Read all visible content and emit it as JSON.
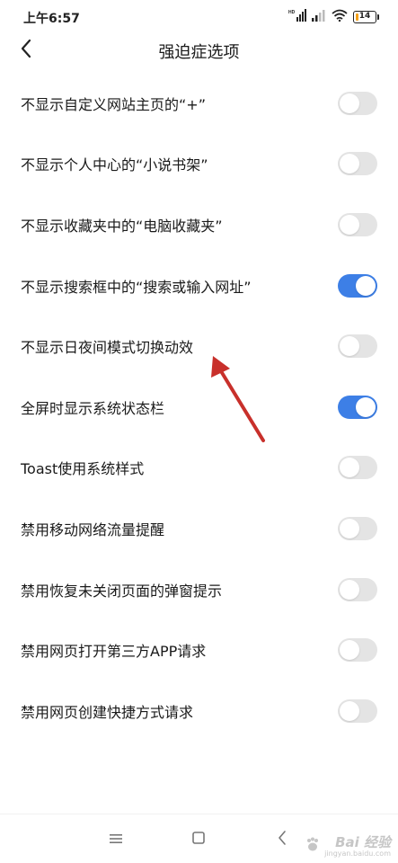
{
  "status_bar": {
    "time": "上午6:57",
    "battery_level": "14",
    "battery_color": "#f4a11a",
    "icons": [
      "hd-signal-icon",
      "signal-icon",
      "wifi-icon",
      "battery-icon"
    ]
  },
  "header": {
    "title": "强迫症选项",
    "back_icon": "back-arrow-icon"
  },
  "settings": [
    {
      "label": "不显示自定义网站主页的“+”",
      "enabled": false
    },
    {
      "label": "不显示个人中心的“小说书架”",
      "enabled": false
    },
    {
      "label": "不显示收藏夹中的“电脑收藏夹”",
      "enabled": false
    },
    {
      "label": "不显示搜索框中的“搜索或输入网址”",
      "enabled": true
    },
    {
      "label": "不显示日夜间模式切换动效",
      "enabled": false
    },
    {
      "label": "全屏时显示系统状态栏",
      "enabled": true
    },
    {
      "label": "Toast使用系统样式",
      "enabled": false
    },
    {
      "label": "禁用移动网络流量提醒",
      "enabled": false
    },
    {
      "label": "禁用恢复未关闭页面的弹窗提示",
      "enabled": false
    },
    {
      "label": "禁用网页打开第三方APP请求",
      "enabled": false
    },
    {
      "label": "禁用网页创建快捷方式请求",
      "enabled": false
    }
  ],
  "colors": {
    "toggle_on": "#3d7fe6",
    "toggle_off": "#e4e4e4",
    "annotation_arrow": "#c8302b"
  },
  "nav_bar": {
    "icons": [
      "menu-icon",
      "home-icon",
      "back-icon"
    ]
  },
  "watermark": {
    "brand": "Bai 经验",
    "url": "jingyan.baidu.com"
  }
}
